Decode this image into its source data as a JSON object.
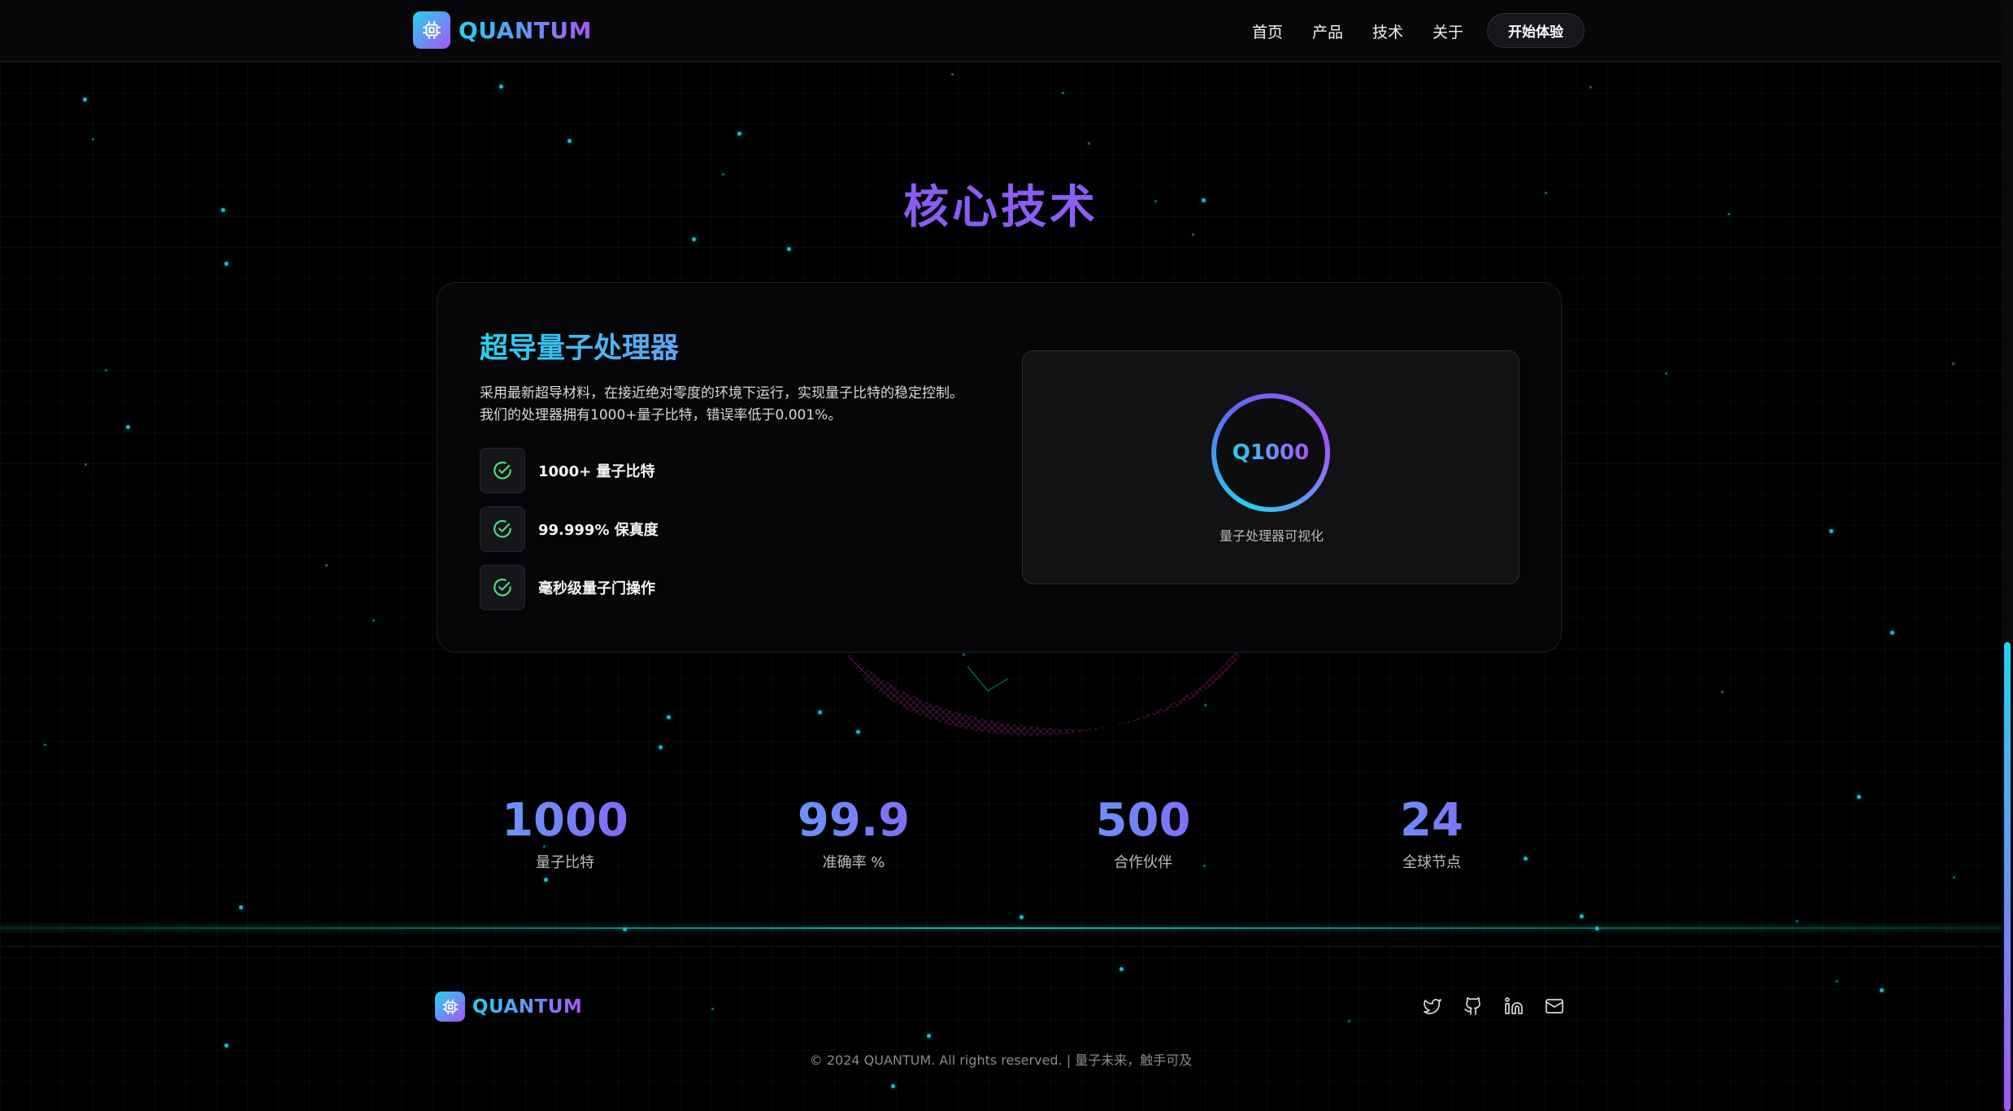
{
  "brand": {
    "name": "QUANTUM",
    "icon": "chip-icon"
  },
  "nav": {
    "items": [
      {
        "label": "首页"
      },
      {
        "label": "产品"
      },
      {
        "label": "技术"
      },
      {
        "label": "关于"
      }
    ],
    "cta": "开始体验"
  },
  "section": {
    "title": "核心技术"
  },
  "card": {
    "title": "超导量子处理器",
    "description": "采用最新超导材料，在接近绝对零度的环境下运行，实现量子比特的稳定控制。 我们的处理器拥有1000+量子比特，错误率低于0.001%。",
    "features": [
      {
        "label": "1000+ 量子比特",
        "icon": "check-circle-icon"
      },
      {
        "label": "99.999% 保真度",
        "icon": "check-circle-icon"
      },
      {
        "label": "毫秒级量子门操作",
        "icon": "check-circle-icon"
      }
    ],
    "visual": {
      "code": "Q1000",
      "caption": "量子处理器可视化"
    }
  },
  "stats": [
    {
      "value": "1000",
      "label": "量子比特"
    },
    {
      "value": "99.9",
      "label": "准确率 %"
    },
    {
      "value": "500",
      "label": "合作伙伴"
    },
    {
      "value": "24",
      "label": "全球节点"
    }
  ],
  "footer": {
    "brand": "QUANTUM",
    "socials": [
      {
        "icon": "twitter-icon"
      },
      {
        "icon": "github-icon"
      },
      {
        "icon": "linkedin-icon"
      },
      {
        "icon": "mail-icon"
      }
    ],
    "copyright": "© 2024 QUANTUM. All rights reserved. | 量子未来，触手可及"
  },
  "colors": {
    "accent_cyan": "#22d3ee",
    "accent_purple": "#a855f7",
    "check_green": "#4ade80",
    "background": "#000000"
  }
}
